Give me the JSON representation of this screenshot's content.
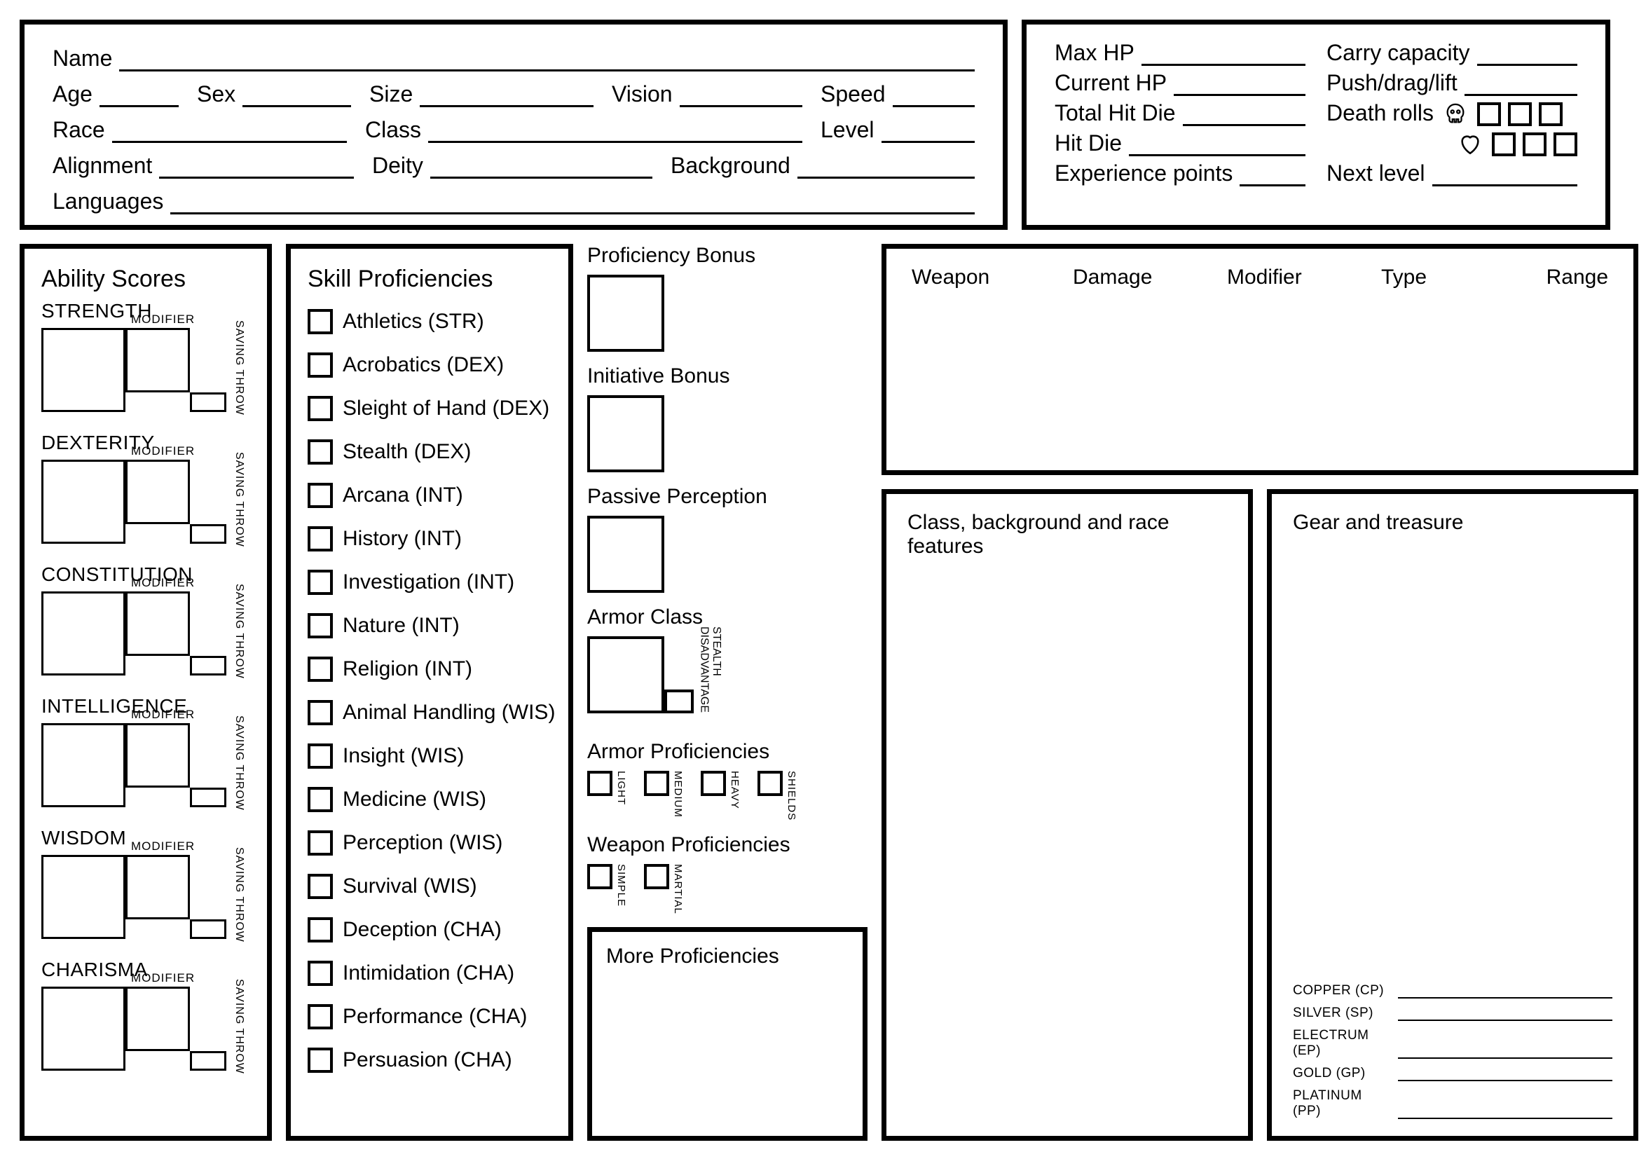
{
  "header": {
    "name": "Name",
    "age": "Age",
    "sex": "Sex",
    "size": "Size",
    "vision": "Vision",
    "speed": "Speed",
    "race": "Race",
    "class": "Class",
    "level": "Level",
    "alignment": "Alignment",
    "deity": "Deity",
    "background": "Background",
    "languages": "Languages"
  },
  "hp": {
    "max": "Max HP",
    "carry": "Carry capacity",
    "current": "Current HP",
    "push": "Push/drag/lift",
    "totalhd": "Total Hit Die",
    "deathrolls": "Death rolls",
    "hitdie": "Hit Die",
    "xp": "Experience points",
    "next": "Next level"
  },
  "ability": {
    "title": "Ability Scores",
    "modifier": "MODIFIER",
    "savingthrow": "SAVING THROW",
    "list": [
      "STRENGTH",
      "DEXTERITY",
      "CONSTITUTION",
      "INTELLIGENCE",
      "WISDOM",
      "CHARISMA"
    ]
  },
  "skills": {
    "title": "Skill Proficiencies",
    "list": [
      "Athletics (STR)",
      "Acrobatics (DEX)",
      "Sleight of Hand (DEX)",
      "Stealth (DEX)",
      "Arcana (INT)",
      "History (INT)",
      "Investigation (INT)",
      "Nature (INT)",
      "Religion (INT)",
      "Animal Handling (WIS)",
      "Insight (WIS)",
      "Medicine (WIS)",
      "Perception (WIS)",
      "Survival (WIS)",
      "Deception (CHA)",
      "Intimidation (CHA)",
      "Performance (CHA)",
      "Persuasion (CHA)"
    ]
  },
  "col3": {
    "profbonus": "Proficiency Bonus",
    "initbonus": "Initiative Bonus",
    "passive": "Passive Perception",
    "ac": "Armor Class",
    "stealthdis": "STEALTH DISADVANTAGE",
    "armorprof": "Armor Proficiencies",
    "armors": [
      "LIGHT",
      "MEDIUM",
      "HEAVY",
      "SHIELDS"
    ],
    "weaponprof": "Weapon Proficiencies",
    "weapons": [
      "SIMPLE",
      "MARTIAL"
    ],
    "more": "More Proficiencies"
  },
  "weapon": {
    "headers": [
      "Weapon",
      "Damage",
      "Modifier",
      "Type",
      "Range"
    ]
  },
  "features": {
    "title": "Class, background and race features"
  },
  "gear": {
    "title": "Gear and treasure",
    "currency": [
      "COPPER (CP)",
      "SILVER (SP)",
      "ELECTRUM (EP)",
      "GOLD (GP)",
      "PLATINUM (PP)"
    ]
  }
}
